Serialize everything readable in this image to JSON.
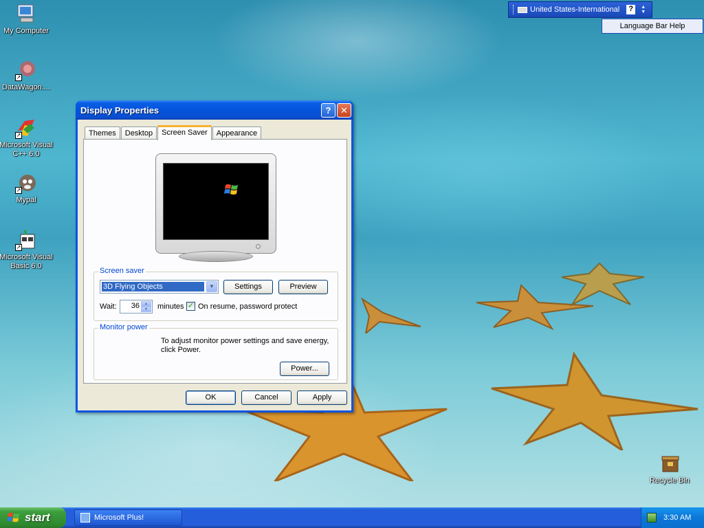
{
  "desktop": {
    "icons": [
      {
        "label": "My Computer"
      },
      {
        "label": "DataWagon...."
      },
      {
        "label": "Microsoft Visual C++ 6.0"
      },
      {
        "label": "Mypal"
      },
      {
        "label": "Microsoft Visual Basic 6.0"
      },
      {
        "label": "Recycle Bin"
      }
    ]
  },
  "language_bar": {
    "language": "United States-International",
    "help_glyph": "?",
    "tooltip": "Language Bar Help"
  },
  "window": {
    "title": "Display Properties",
    "help_glyph": "?",
    "close_glyph": "✕",
    "tabs": [
      {
        "label": "Themes"
      },
      {
        "label": "Desktop"
      },
      {
        "label": "Screen Saver",
        "active": true
      },
      {
        "label": "Appearance"
      }
    ],
    "screen_saver": {
      "group_label": "Screen saver",
      "selected": "3D Flying Objects",
      "settings_label": "Settings",
      "preview_label": "Preview",
      "wait_label": "Wait:",
      "wait_value": "36",
      "minutes_label": "minutes",
      "password_label": "On resume, password protect",
      "password_checked": true
    },
    "monitor_power": {
      "group_label": "Monitor power",
      "description": "To adjust monitor power settings and save energy, click Power.",
      "power_label": "Power..."
    },
    "buttons": {
      "ok": "OK",
      "cancel": "Cancel",
      "apply": "Apply"
    }
  },
  "taskbar": {
    "start_label": "start",
    "task": "Microsoft Plus!",
    "clock": "3:30 AM"
  },
  "colors": {
    "titlebar": "#0553dc",
    "start_green": "#3c9f3c",
    "taskbar_blue": "#245edb",
    "selection": "#316ac5"
  }
}
